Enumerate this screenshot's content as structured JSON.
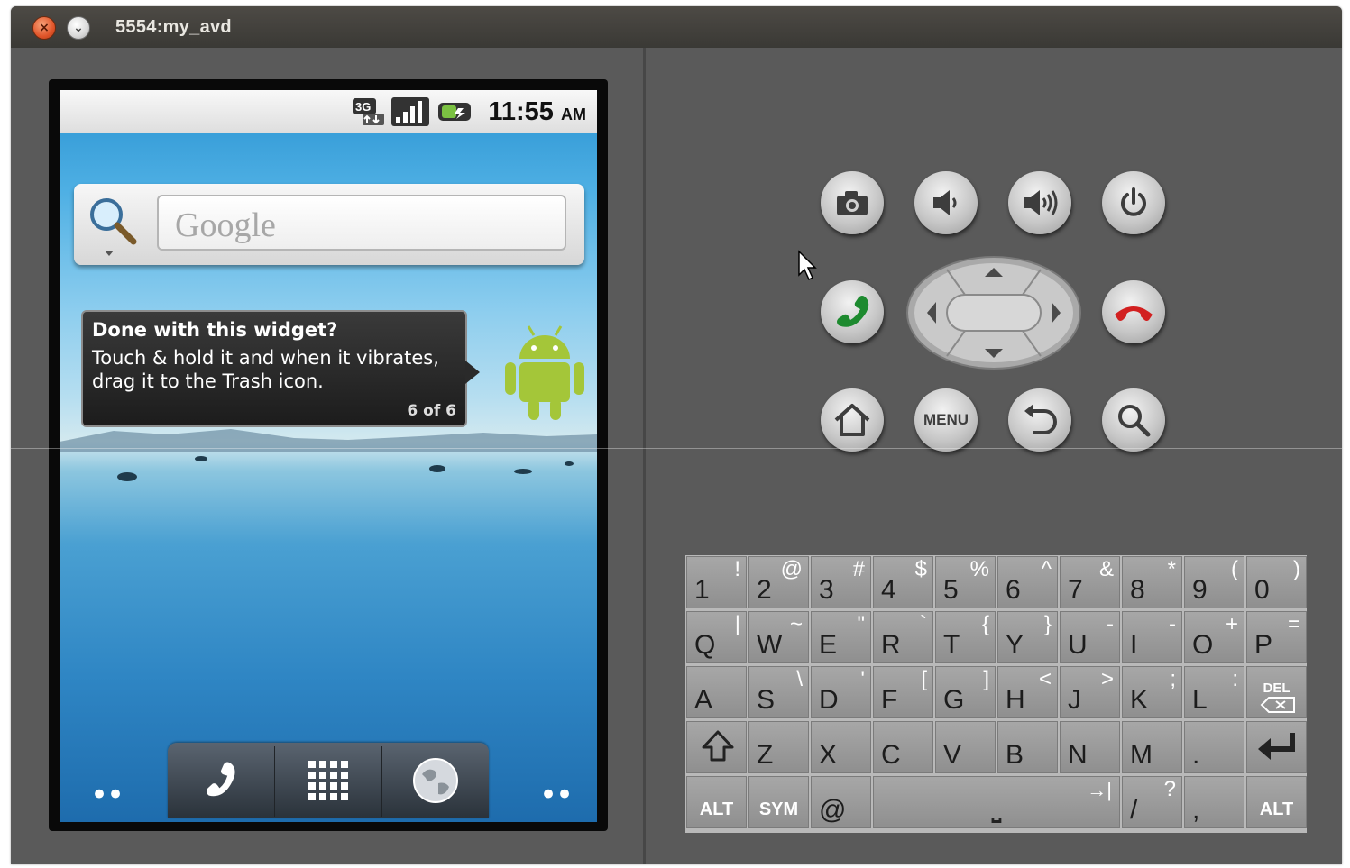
{
  "window": {
    "title": "5554:my_avd",
    "close_glyph": "×",
    "minimize_glyph": "⌄"
  },
  "phone": {
    "status": {
      "time": "11:55",
      "ampm": "AM",
      "network_label": "3G"
    },
    "search": {
      "placeholder_logo": "Google"
    },
    "tip": {
      "title": "Done with this widget?",
      "body": "Touch & hold it and when it vibrates, drag it to the Trash icon.",
      "count": "6 of 6"
    },
    "dock": {
      "left_dots": "••",
      "right_dots": "••"
    }
  },
  "controls": {
    "menu_label": "MENU",
    "icons": [
      "camera-icon",
      "volume-down-icon",
      "volume-up-icon",
      "power-icon",
      "call-icon",
      "end-call-icon",
      "home-icon",
      "menu-button",
      "back-icon",
      "search-icon"
    ]
  },
  "keyboard": {
    "row1": [
      {
        "main": "1",
        "alt": "!"
      },
      {
        "main": "2",
        "alt": "@"
      },
      {
        "main": "3",
        "alt": "#"
      },
      {
        "main": "4",
        "alt": "$"
      },
      {
        "main": "5",
        "alt": "%"
      },
      {
        "main": "6",
        "alt": "^"
      },
      {
        "main": "7",
        "alt": "&"
      },
      {
        "main": "8",
        "alt": "*"
      },
      {
        "main": "9",
        "alt": "("
      },
      {
        "main": "0",
        "alt": ")"
      }
    ],
    "row2": [
      {
        "main": "Q",
        "alt": "|"
      },
      {
        "main": "W",
        "alt": "~"
      },
      {
        "main": "E",
        "alt": "\""
      },
      {
        "main": "R",
        "alt": "`"
      },
      {
        "main": "T",
        "alt": "{"
      },
      {
        "main": "Y",
        "alt": "}"
      },
      {
        "main": "U",
        "alt": "-"
      },
      {
        "main": "I",
        "alt": "-"
      },
      {
        "main": "O",
        "alt": "+"
      },
      {
        "main": "P",
        "alt": "="
      }
    ],
    "row3": [
      {
        "main": "A",
        "alt": ""
      },
      {
        "main": "S",
        "alt": "\\"
      },
      {
        "main": "D",
        "alt": "'"
      },
      {
        "main": "F",
        "alt": "["
      },
      {
        "main": "G",
        "alt": "]"
      },
      {
        "main": "H",
        "alt": "<"
      },
      {
        "main": "J",
        "alt": ">"
      },
      {
        "main": "K",
        "alt": ";"
      },
      {
        "main": "L",
        "alt": ":"
      }
    ],
    "del_label": "DEL",
    "row4": [
      {
        "main": "Z",
        "alt": ""
      },
      {
        "main": "X",
        "alt": ""
      },
      {
        "main": "C",
        "alt": ""
      },
      {
        "main": "V",
        "alt": ""
      },
      {
        "main": "B",
        "alt": ""
      },
      {
        "main": "N",
        "alt": ""
      },
      {
        "main": "M",
        "alt": ""
      },
      {
        "main": ".",
        "alt": ""
      }
    ],
    "alt_left": "ALT",
    "sym": "SYM",
    "at": "@",
    "space_glyph": "⎵",
    "tab_glyph": "→|",
    "slash": {
      "main": "/",
      "alt": "?"
    },
    "comma": {
      "main": ",",
      "alt": ""
    },
    "alt_right": "ALT"
  }
}
